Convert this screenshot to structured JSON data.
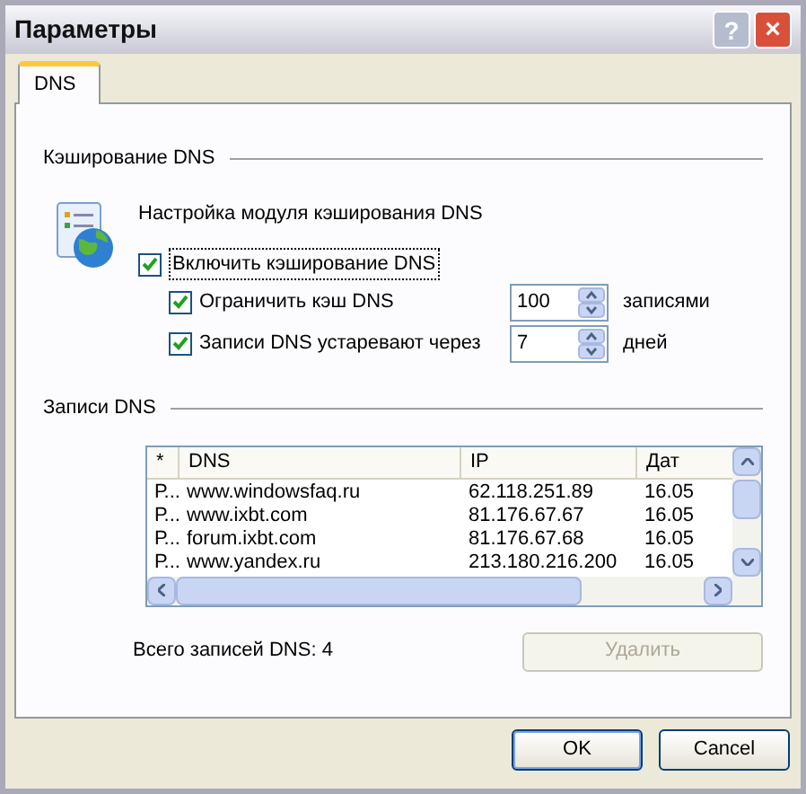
{
  "window": {
    "title": "Параметры",
    "buttons": [
      "?",
      "×"
    ]
  },
  "tabs": [
    {
      "label": "DNS",
      "selected": true
    }
  ],
  "caching": {
    "heading": "Кэширование DNS",
    "description": "Настройка модуля кэширования DNS",
    "enable": {
      "label": "Включить кэширование DNS",
      "checked": true,
      "children": [
        {
          "label": "Ограничить кэш DNS",
          "checked": true,
          "value": "100",
          "unit": "записями"
        },
        {
          "label": "Записи DNS устаревают через",
          "checked": true,
          "value": "7",
          "unit": "дней"
        }
      ]
    }
  },
  "records": {
    "heading": "Записи DNS",
    "table": {
      "columns": [
        "*",
        "DNS",
        "IP",
        "Дат"
      ],
      "rows": [
        [
          "Р...",
          "www.windowsfaq.ru",
          "62.118.251.89",
          "16.05"
        ],
        [
          "Р...",
          "www.ixbt.com",
          "81.176.67.67",
          "16.05"
        ],
        [
          "Р...",
          "forum.ixbt.com",
          "81.176.67.68",
          "16.05"
        ],
        [
          "Р...",
          "www.yandex.ru",
          "213.180.216.200",
          "16.05"
        ]
      ]
    },
    "total": "Всего записей DNS: 4",
    "delete": {
      "label": "Удалить",
      "disabled": true
    }
  },
  "buttons": [
    "OK",
    "Cancel"
  ]
}
